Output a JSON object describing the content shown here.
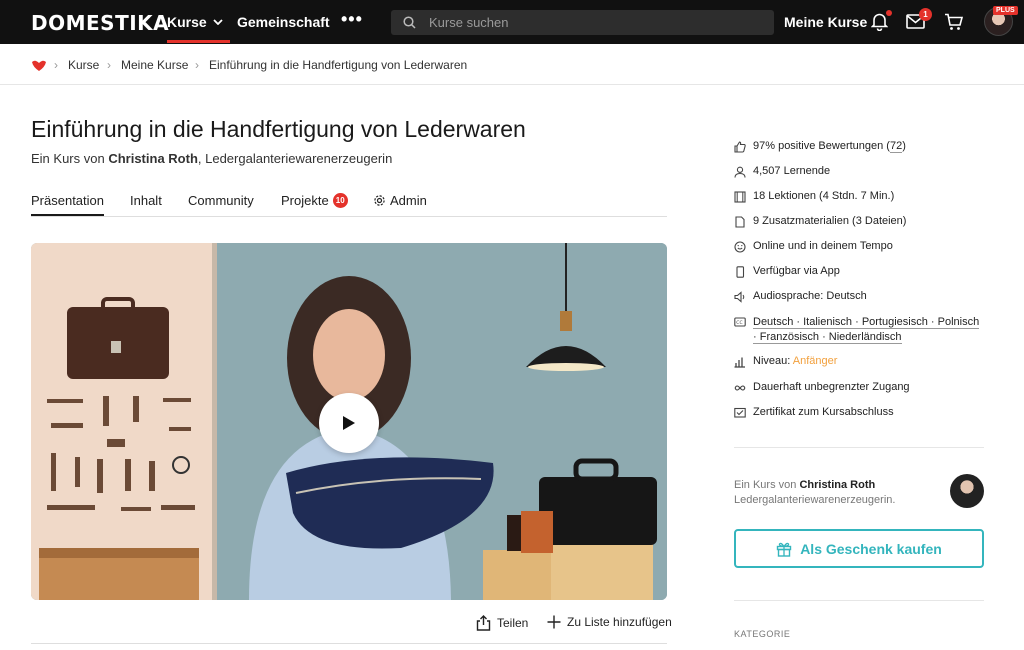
{
  "nav": {
    "logo": "DOMESTIKA",
    "kurse": "Kurse",
    "gemeinschaft": "Gemeinschaft",
    "more": "•••",
    "search_placeholder": "Kurse suchen",
    "meine_kurse": "Meine Kurse",
    "mail_count": "1",
    "plus": "PLUS"
  },
  "breadcrumb": {
    "items": [
      "Kurse",
      "Meine Kurse",
      "Einführung in die Handfertigung von Lederwaren"
    ]
  },
  "course": {
    "title": "Einführung in die Handfertigung von Lederwaren",
    "by_prefix": "Ein Kurs von",
    "author": "Christina Roth",
    "author_role": ", Ledergalanteriewarenerzeugerin"
  },
  "tabs": {
    "praesentation": "Präsentation",
    "inhalt": "Inhalt",
    "community": "Community",
    "projekte": "Projekte",
    "projekte_count": "10",
    "admin": "Admin"
  },
  "actions": {
    "share": "Teilen",
    "add_list": "Zu Liste hinzufügen"
  },
  "sidebar": {
    "rating": "97% positive Bewertungen (",
    "rating_count": "72",
    "rating_close": ")",
    "learners": "4,507 Lernende",
    "lessons": "18 Lektionen (4 Stdn. 7 Min.)",
    "materials": "9 Zusatzmaterialien (3 Dateien)",
    "online": "Online und in deinem Tempo",
    "app": "Verfügbar via App",
    "audio": "Audiosprache: Deutsch",
    "subtitles_1": "Deutsch · Italienisch · Portugiesisch · Polnisch",
    "subtitles_2": "· Französisch · Niederländisch",
    "level_label": "Niveau: ",
    "level_value": "Anfänger",
    "access": "Dauerhaft unbegrenzter Zugang",
    "certificate": "Zertifikat zum Kursabschluss",
    "author_prefix": "Ein Kurs von",
    "author_name": "Christina Roth",
    "author_role": "Ledergalanteriewarenerzeugerin.",
    "gift_button": "Als Geschenk kaufen",
    "category_label": "KATEGORIE"
  },
  "colors": {
    "brand_red": "#e4322b",
    "teal": "#34b5bd",
    "level_orange": "#f2a03d"
  }
}
